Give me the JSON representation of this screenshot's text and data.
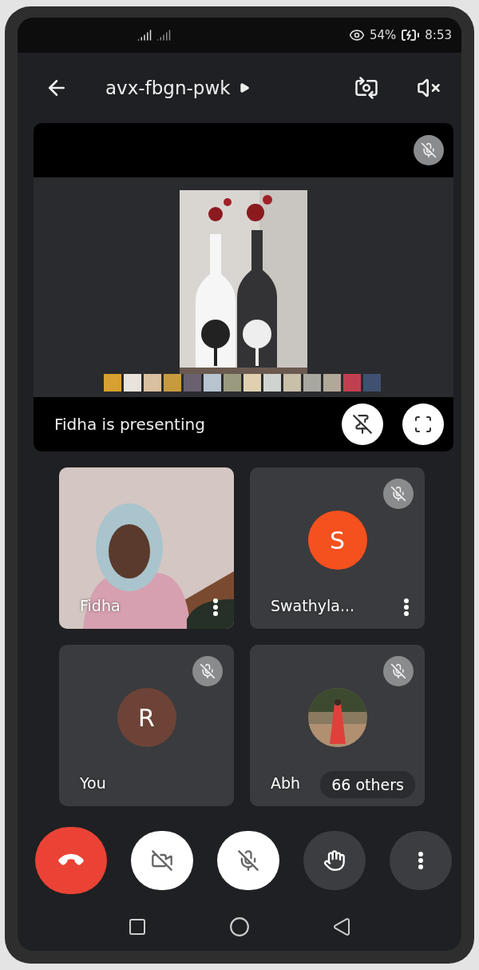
{
  "status_bar": {
    "battery": "54%",
    "time": "8:53"
  },
  "header": {
    "title": "avx-fbgn-pwk"
  },
  "presentation": {
    "muted": true,
    "presenter_text": "Fidha is presenting"
  },
  "tiles": [
    {
      "kind": "video",
      "name": "Fidha",
      "muted": false,
      "menu": true
    },
    {
      "kind": "avatar",
      "name": "Swathyla...",
      "initial": "S",
      "color": "#f4511e",
      "muted": true,
      "menu": true
    },
    {
      "kind": "avatar",
      "name": "You",
      "initial": "R",
      "color": "#6d4337",
      "muted": true
    },
    {
      "name": "Abh",
      "muted": true,
      "badge": "66 others"
    }
  ],
  "controls": [
    {
      "kind": "end"
    },
    {
      "kind": "camera",
      "on": false
    },
    {
      "kind": "mic",
      "on": false
    },
    {
      "kind": "hand"
    },
    {
      "kind": "more"
    }
  ]
}
